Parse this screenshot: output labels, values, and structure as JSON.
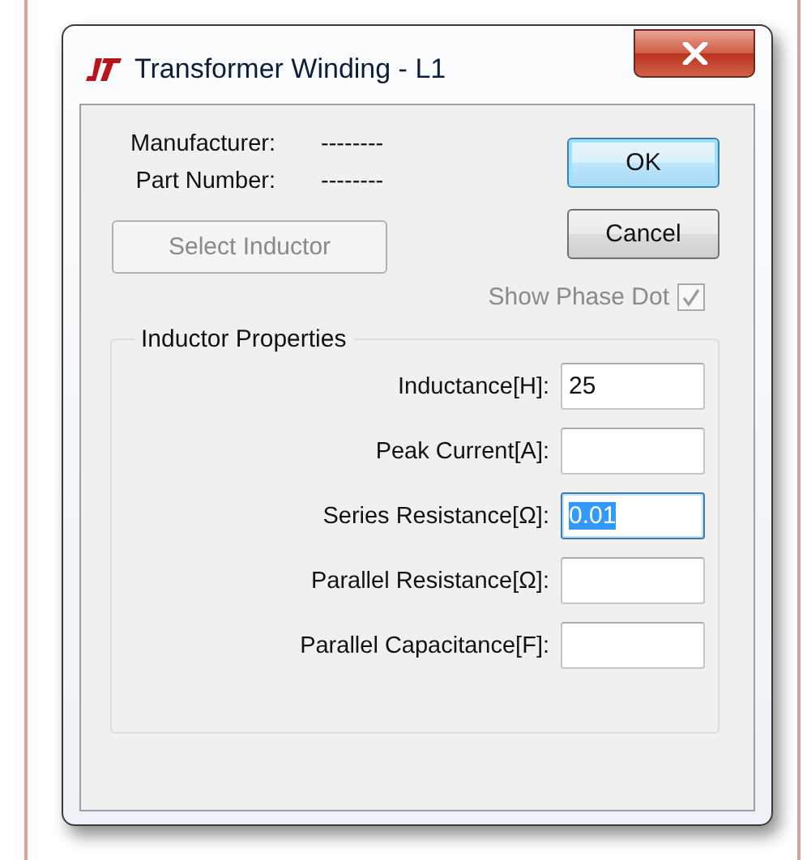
{
  "window": {
    "title": "Transformer Winding - L1"
  },
  "info": [
    {
      "label": "Manufacturer:",
      "value": "--------"
    },
    {
      "label": "Part Number:",
      "value": "--------"
    }
  ],
  "select_button": {
    "label": "Select Inductor",
    "disabled": true
  },
  "buttons": [
    {
      "label": "OK",
      "default": true
    },
    {
      "label": "Cancel",
      "default": false
    }
  ],
  "show_phase_dot": {
    "label": "Show Phase Dot",
    "checked": true,
    "disabled": true
  },
  "group": {
    "title": "Inductor Properties",
    "fields": [
      {
        "label": "Inductance[H]:",
        "value": "25",
        "focused": false
      },
      {
        "label": "Peak Current[A]:",
        "focused": false
      },
      {
        "label": "Series Resistance[Ω]:",
        "value": "0.01",
        "focused": true
      },
      {
        "label": "Parallel Resistance[Ω]:",
        "focused": false
      },
      {
        "label": "Parallel Capacitance[F]:",
        "focused": false
      }
    ]
  }
}
